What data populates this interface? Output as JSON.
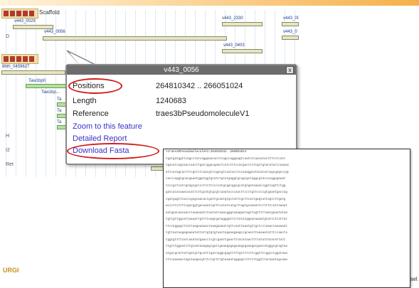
{
  "tracks": [
    {
      "title": "Scaffold"
    },
    {
      "title": ""
    }
  ],
  "feature_labels": [
    "v443_0029",
    "v443_2330",
    "v443_00",
    "v443_0056",
    "v443_0",
    "v443_0403",
    "8hth_0459627",
    "Taw1bp0",
    "Taw1bp...",
    "Ta",
    "Ta",
    "Ta"
  ],
  "side_chars": [
    "D",
    "H",
    "I2",
    "Ret"
  ],
  "popup": {
    "title": "v443_0056",
    "rows": [
      {
        "label": "Positions",
        "value": "264810342 .. 266051024"
      },
      {
        "label": "Length",
        "value": "1240683"
      },
      {
        "label": "Reference",
        "value": "traes3bPseudomoleculeV1"
      }
    ],
    "links": [
      "Zoom to this feature",
      "Detailed Report",
      "Download Fasta"
    ],
    "close": "x"
  },
  "fasta": {
    "header": ">traes3bPseudomoleculeV1:264810342..266051024",
    "lines": [
      "tgatgatggttcagcctatcaggaaacacttcagccaggaagtcaatctcaacatacttttctcatc",
      "tgacatcagcaaccaacttgatcggacgaactcatctttccacgacctcttgctgtacatactcaaaac",
      "attcacagcactttcgctctcaacgtccgacgtcaatacctccaaaggtatacataccagcgagcccgt",
      "cacccaggtgcacgaaatggatggtgcatctgtatgaggtgcagcgctaggcgtaccacggagaaat",
      "tcccgctcatcgtagcgccccttcttccccatgcgacggcgcatgtgataaaaccggtcagttctgg",
      "gatcacacaaacacattcttgcatgtgcgtcaaatacccaacttccctgttccccgtgaaatgaccag",
      "cgatgagtttacccgagcaacactgattgcaatgtgctatttgcttcactgagtattagtcttgatg",
      "acccttcttttcgacggtgacaaatcgtttcatatcatgcttagtgcaaaattctttttcattaaaat",
      "aatgaacaacaacctaaaaaatctaatattaaacgggcaaagaatagttagtttttaatgaaatataa",
      "tgttgttggcattaaaattgttttaagtgatagggatttctatatggaataaaatgtattcttattat",
      "ttccaggagcttattaagaaaaactaaagaaaattgttcaattaaatgttgctcccaaaccaaaaaat",
      "tgttaataagagaaaatattattgtgtgtaactagaaagaagccgcaacttaaaaatatttccaacta",
      "tggtgttttcatcaaatatgaacctcgtcgaattgaacttcacataacttttatattatatattatt",
      "ttgcttggaatcttgcaataaagagcgatcgaaagagagaaagagaaagacgaacatgggcgtagtaa",
      "atgacgcattattgatgttgcatttgaccaggcgagtttttgttttcttcggtttcggcctggataaa",
      "tttcaaaaactagcaaagacgtttctgttttgtaaaataggagtcttctttggtttacaaatagcaaa"
    ]
  },
  "logo": "URGI",
  "author": "ael Alaux",
  "colors": {
    "link": "#3a32c8",
    "highlight": "#d21c1c",
    "header_bar": "#f6b04a"
  }
}
